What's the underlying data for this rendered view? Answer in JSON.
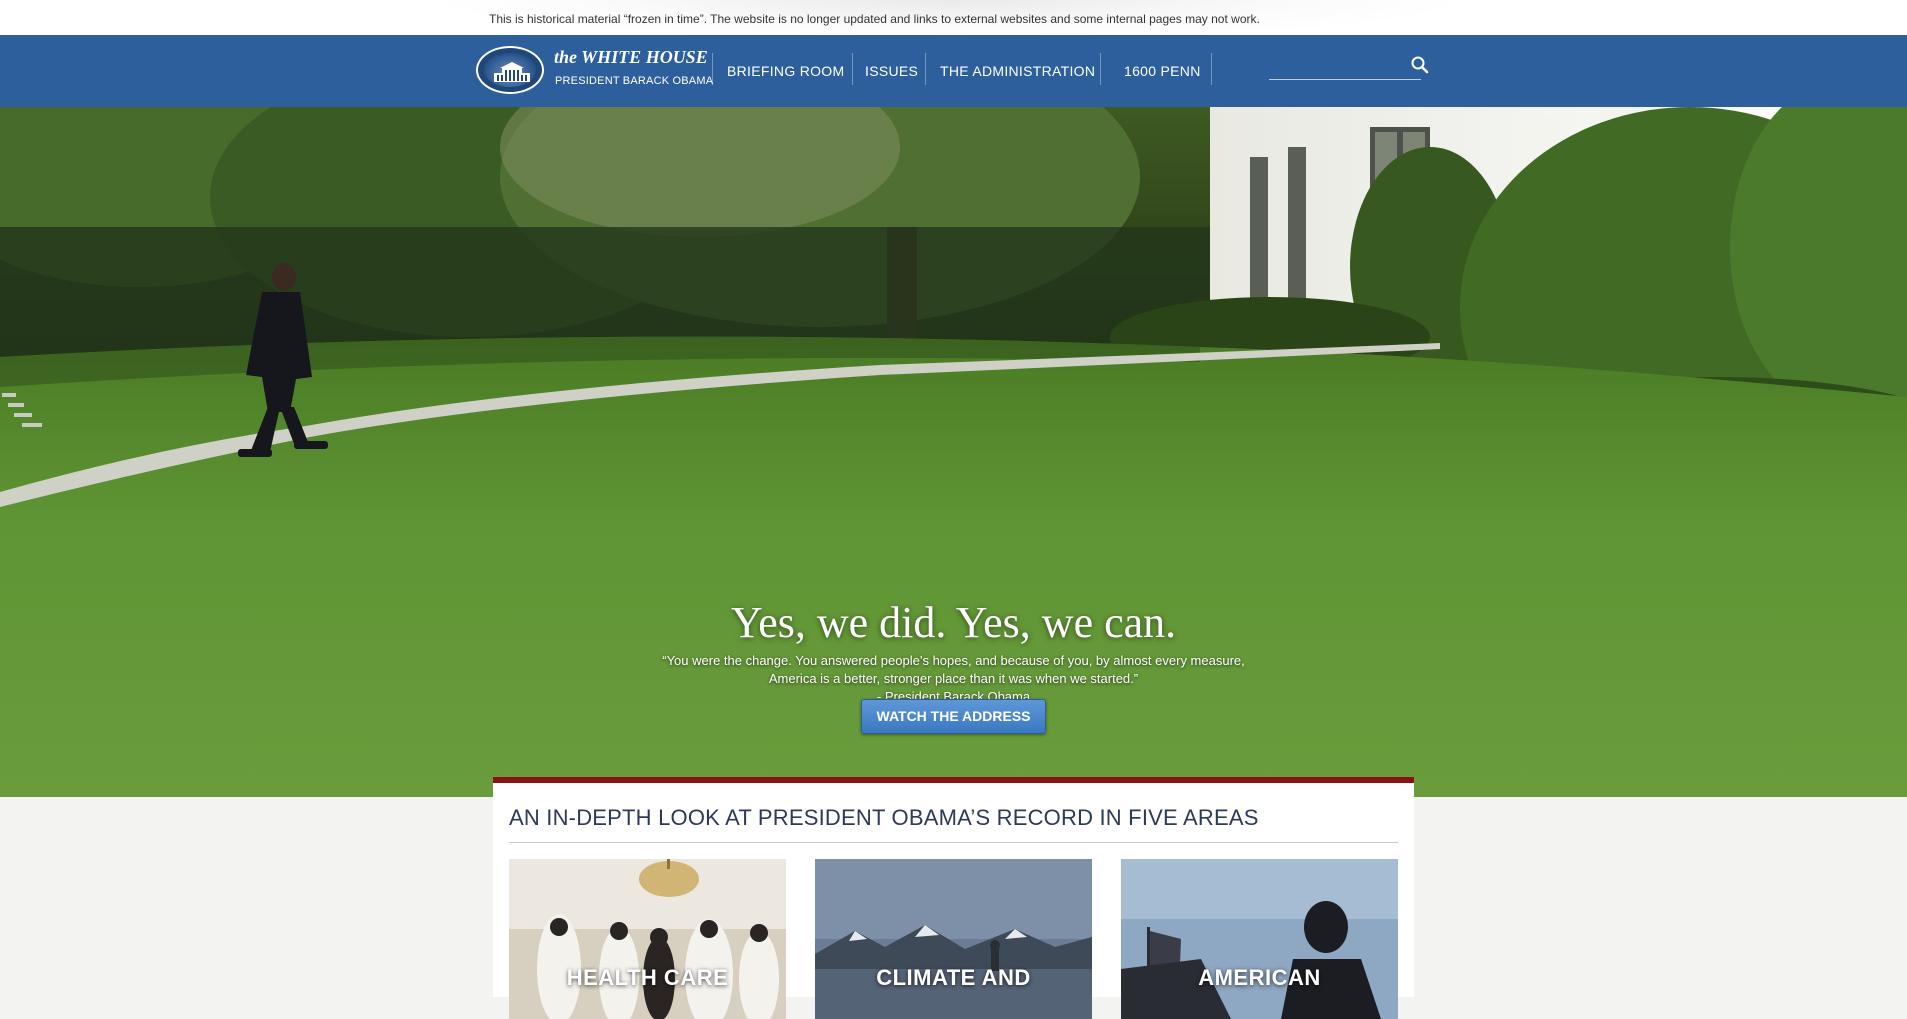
{
  "notice": {
    "text": "This is historical material “frozen in time”. The website is no longer updated and links to external websites and some internal pages may not work."
  },
  "header": {
    "logo_title": "the WHITE HOUSE",
    "logo_subtitle": "PRESIDENT BARACK OBAMA",
    "nav": [
      {
        "label": "BRIEFING ROOM"
      },
      {
        "label": "ISSUES"
      },
      {
        "label": "THE ADMINISTRATION"
      },
      {
        "label": "1600 PENN"
      }
    ],
    "search": {
      "placeholder": "",
      "value": ""
    }
  },
  "hero": {
    "headline": "Yes, we did. Yes, we can.",
    "quote_line1": "“You were the change. You answered people’s hopes, and because of you, by almost every measure,",
    "quote_line2": "America is a better, stronger place than it was when we started.”",
    "attribution": "- President Barack Obama",
    "button_label": "WATCH THE ADDRESS"
  },
  "record": {
    "title": "AN IN-DEPTH LOOK AT PRESIDENT OBAMA’S RECORD IN FIVE AREAS",
    "cards": [
      {
        "label": "HEALTH CARE"
      },
      {
        "label": "CLIMATE AND"
      },
      {
        "label": "AMERICAN"
      }
    ]
  },
  "colors": {
    "nav_blue": "#2c5f9c",
    "button_blue": "#3c78bf",
    "accent_red": "#8a1214",
    "title_navy": "#2d3a57"
  }
}
